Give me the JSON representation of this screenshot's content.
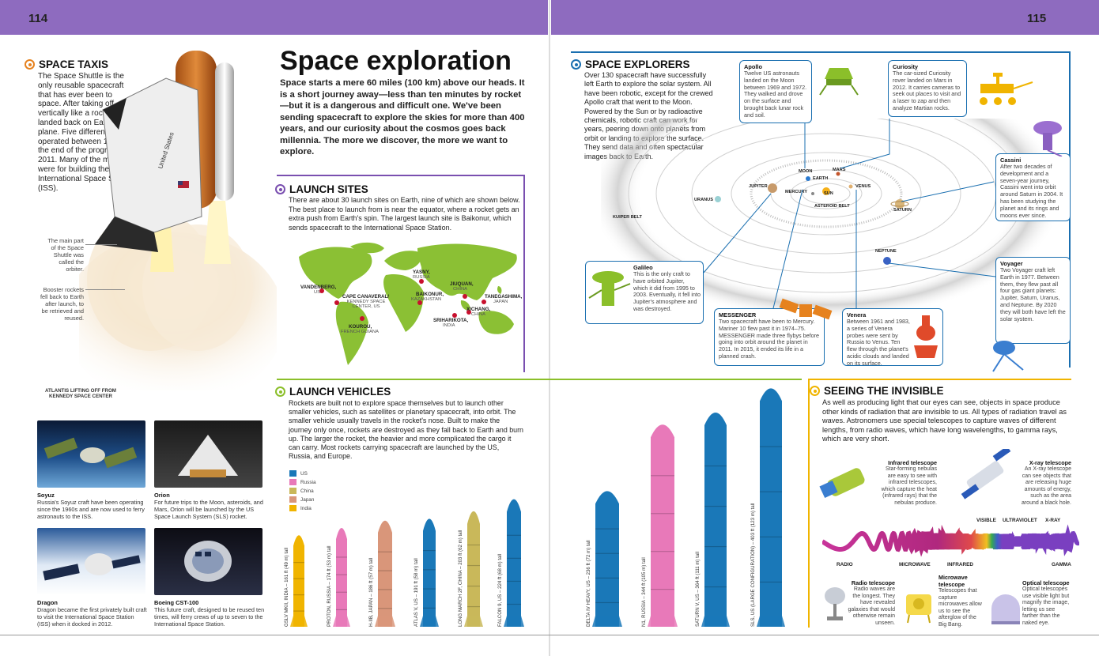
{
  "page": {
    "left_number": "114",
    "right_number": "115",
    "title": "Space exploration",
    "intro": "Space starts a mere 60 miles (100 km) above our heads. It is a short journey away—less than ten minutes by rocket—but it is a dangerous and difficult one. We've been sending spacecraft to explore the skies for more than 400 years, and our curiosity about the cosmos goes back millennia. The more we discover, the more we want to explore."
  },
  "colors": {
    "header_band": "#8e6bbf",
    "orange": "#e6821e",
    "purple": "#7a4fb0",
    "green": "#8bbf2a",
    "blue": "#1a6fb0",
    "yellow": "#f0b400",
    "map_green": "#8bc034",
    "site_red": "#c8102e"
  },
  "space_taxis": {
    "title": "SPACE TAXIS",
    "text": "The Space Shuttle is the only reusable spacecraft that has ever been to space. After taking off vertically like a rocket, it landed back on Earth like a plane. Five different shuttles operated between 1981 and the end of the program in 2011. Many of the missions were for building the International Space Station (ISS).",
    "annotation_orbiter": "The main part of the Space Shuttle was called the orbiter.",
    "annotation_boosters": "Booster rockets fell back to Earth after launch, to be retrieved and reused.",
    "photo_caption": "ATLANTIS LIFTING OFF FROM KENNEDY SPACE CENTER",
    "craft": [
      {
        "name": "Soyuz",
        "text": "Russia's Soyuz craft have been operating since the 1960s and are now used to ferry astronauts to the ISS."
      },
      {
        "name": "Orion",
        "text": "For future trips to the Moon, asteroids, and Mars, Orion will be launched by the US Space Launch System (SLS) rocket."
      },
      {
        "name": "Dragon",
        "text": "Dragon became the first privately built craft to visit the International Space Station (ISS) when it docked in 2012."
      },
      {
        "name": "Boeing CST-100",
        "text": "This future craft, designed to be reused ten times, will ferry crews of up to seven to the International Space Station."
      }
    ]
  },
  "launch_sites": {
    "title": "LAUNCH SITES",
    "text": "There are about 30 launch sites on Earth, nine of which are shown below. The best place to launch from is near the equator, where a rocket gets an extra push from Earth's spin. The largest launch site is Baikonur, which sends spacecraft to the International Space Station.",
    "sites": [
      {
        "name": "VANDENBERG,",
        "country": "US"
      },
      {
        "name": "CAPE CANAVERAL/",
        "country": "KENNEDY SPACE CENTER, US"
      },
      {
        "name": "KOUROU,",
        "country": "FRENCH GUIANA"
      },
      {
        "name": "YASNY,",
        "country": "RUSSIA"
      },
      {
        "name": "BAIKONUR,",
        "country": "KAZAKHSTAN"
      },
      {
        "name": "JIUQUAN,",
        "country": "CHINA"
      },
      {
        "name": "XICHANG,",
        "country": "CHINA"
      },
      {
        "name": "TANEGASHIMA,",
        "country": "JAPAN"
      },
      {
        "name": "SRIHARIKOTA,",
        "country": "INDIA"
      }
    ]
  },
  "launch_vehicles": {
    "title": "LAUNCH VEHICLES",
    "text": "Rockets are built not to explore space themselves but to launch other smaller vehicles, such as satellites or planetary spacecraft, into orbit. The smaller vehicle usually travels in the rocket's nose. Built to make the journey only once, rockets are destroyed as they fall back to Earth and burn up. The larger the rocket, the heavier and more complicated the cargo it can carry. Most rockets carrying spacecraft are launched by the US, Russia, and Europe.",
    "legend": [
      {
        "label": "US",
        "color": "#1a78b8"
      },
      {
        "label": "Russia",
        "color": "#e879b9"
      },
      {
        "label": "China",
        "color": "#c9b85a"
      },
      {
        "label": "Japan",
        "color": "#d9967a"
      },
      {
        "label": "India",
        "color": "#f0b400"
      }
    ],
    "rockets": [
      {
        "label": "GSLV MKII, INDIA – 161 ft (49 m) tall",
        "height_m": 49,
        "color": "#f0b400"
      },
      {
        "label": "PROTON, RUSSIA – 174 ft (53 m) tall",
        "height_m": 53,
        "color": "#e879b9"
      },
      {
        "label": "H-IIB, JAPAN – 186 ft (57 m) tall",
        "height_m": 57,
        "color": "#d9967a"
      },
      {
        "label": "ATLAS V, US – 191 ft (58 m) tall",
        "height_m": 58,
        "color": "#1a78b8"
      },
      {
        "label": "LONG MARCH 2F, CHINA – 203 ft (62 m) tall",
        "height_m": 62,
        "color": "#c9b85a"
      },
      {
        "label": "FALCON 9, US – 224 ft (68 m) tall",
        "height_m": 68,
        "color": "#1a78b8"
      },
      {
        "label": "DELTA IV HEAVY, US – 236 ft (72 m) tall",
        "height_m": 72,
        "color": "#1a78b8"
      },
      {
        "label": "N1, RUSSIA – 344 ft (105 m) tall",
        "height_m": 105,
        "color": "#e879b9"
      },
      {
        "label": "SATURN V, US – 364 ft (111 m) tall",
        "height_m": 111,
        "color": "#1a78b8"
      },
      {
        "label": "SLS, US (LARGE CONFIGURATION) – 403 ft (123 m) tall",
        "height_m": 123,
        "color": "#1a78b8"
      }
    ]
  },
  "space_explorers": {
    "title": "SPACE EXPLORERS",
    "text": "Over 130 spacecraft have successfully left Earth to explore the solar system. All have been robotic, except for the crewed Apollo craft that went to the Moon. Powered by the Sun or by radioactive chemicals, robotic craft can work for years, peering down onto planets from orbit or landing to explore the surface. They send data and often spectacular images back to Earth.",
    "callouts": [
      {
        "name": "Apollo",
        "text": "Twelve US astronauts landed on the Moon between 1969 and 1972. They walked and drove on the surface and brought back lunar rock and soil."
      },
      {
        "name": "Curiosity",
        "text": "The car-sized Curiosity rover landed on Mars in 2012. It carries cameras to seek out places to visit and a laser to zap and then analyze Martian rocks."
      },
      {
        "name": "Cassini",
        "text": "After two decades of development and a seven-year journey, Cassini went into orbit around Saturn in 2004. It has been studying the planet and its rings and moons ever since."
      },
      {
        "name": "Galileo",
        "text": "This is the only craft to have orbited Jupiter, which it did from 1995 to 2003. Eventually, it fell into Jupiter's atmosphere and was destroyed."
      },
      {
        "name": "MESSENGER",
        "text": "Two spacecraft have been to Mercury. Mariner 10 flew past it in 1974–75. MESSENGER made three flybys before going into orbit around the planet in 2011. In 2015, it ended its life in a planned crash."
      },
      {
        "name": "Venera",
        "text": "Between 1961 and 1983, a series of Venera probes were sent by Russia to Venus. Ten flew through the planet's acidic clouds and landed on its surface."
      },
      {
        "name": "Voyager",
        "text": "Two Voyager craft left Earth in 1977. Between them, they flew past all four gas giant planets: Jupiter, Saturn, Uranus, and Neptune. By 2020 they will both have left the solar system."
      }
    ],
    "bodies": {
      "moon": "MOON",
      "earth": "EARTH",
      "mars": "MARS",
      "jupiter": "JUPITER",
      "mercury": "MERCURY",
      "sun": "SUN",
      "venus": "VENUS",
      "uranus": "URANUS",
      "saturn": "SATURN",
      "asteroid_belt": "ASTEROID BELT",
      "kuiper_belt": "KUIPER BELT",
      "neptune": "NEPTUNE"
    }
  },
  "seeing_invisible": {
    "title": "SEEING THE INVISIBLE",
    "text": "As well as producing light that our eyes can see, objects in space produce other kinds of radiation that are invisible to us. All types of radiation travel as waves. Astronomers use special telescopes to capture waves of different lengths, from radio waves, which have long wavelengths, to gamma rays, which are very short.",
    "bands": [
      "RADIO",
      "MICROWAVE",
      "INFRARED",
      "VISIBLE",
      "ULTRAVIOLET",
      "X-RAY",
      "GAMMA"
    ],
    "telescopes": [
      {
        "name": "Infrared telescope",
        "text": "Star-forming nebulas are easy to see with infrared telescopes, which capture the heat (infrared rays) that the nebulas produce."
      },
      {
        "name": "X-ray telescope",
        "text": "An X-ray telescope can see objects that are releasing huge amounts of energy, such as the area around a black hole."
      },
      {
        "name": "Radio telescope",
        "text": "Radio waves are the longest. They have revealed galaxies that would otherwise remain unseen."
      },
      {
        "name": "Microwave telescope",
        "text": "Telescopes that capture microwaves allow us to see the afterglow of the Big Bang."
      },
      {
        "name": "Optical telescope",
        "text": "Optical telescopes use visible light but magnify the image, letting us see farther than the naked eye."
      }
    ]
  }
}
